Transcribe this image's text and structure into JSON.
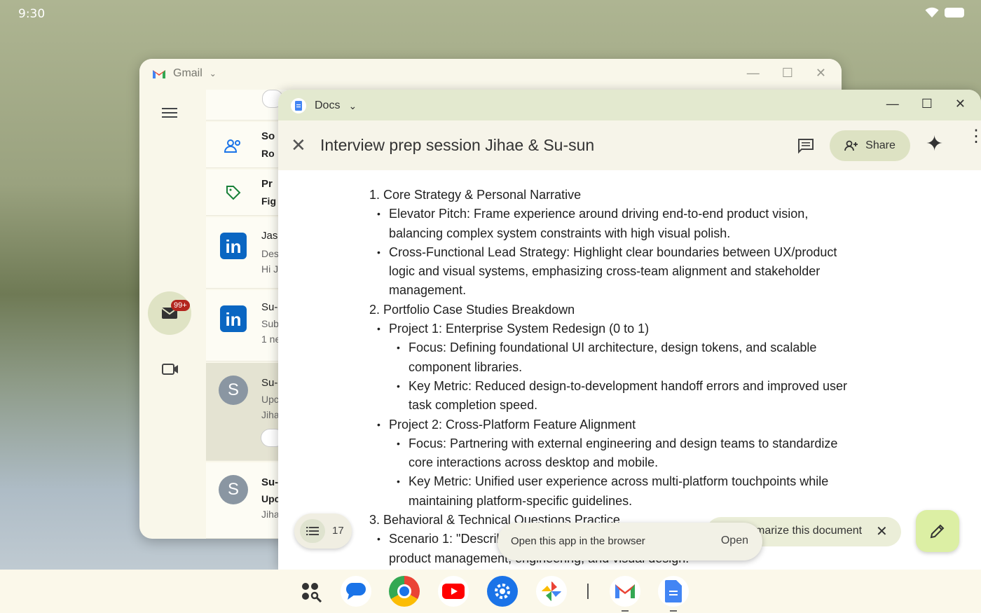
{
  "status_bar": {
    "time": "9:30"
  },
  "gmail": {
    "app_name": "Gmail",
    "badge": "99+",
    "rows": [
      {
        "line1": "So",
        "line2": "Ro"
      },
      {
        "line1": "Pr",
        "line2": "Fig"
      },
      {
        "line1": "Jas",
        "line2": "Des",
        "line3": "Hi J"
      },
      {
        "line1": "Su-",
        "line2": "Sub",
        "line3": "1 ne"
      },
      {
        "avatar": "S",
        "line1": "Su-",
        "line2": "Upc",
        "line3": "Jiha"
      },
      {
        "avatar": "S",
        "line1": "Su-",
        "line2": "Upc",
        "line3": "Jiha"
      }
    ]
  },
  "docs": {
    "app_name": "Docs",
    "title": "Interview prep session  Jihae & Su-sun",
    "share_label": "Share",
    "lines": [
      "1. Core Strategy & Personal Narrative",
      "Elevator Pitch: Frame experience around driving end-to-end product vision,",
      "balancing complex system constraints with high visual polish.",
      "Cross-Functional Lead Strategy: Highlight clear boundaries between UX/product",
      "logic and visual systems, emphasizing cross-team alignment and stakeholder",
      "management.",
      "2. Portfolio Case Studies Breakdown",
      "Project 1: Enterprise System Redesign (0 to 1)",
      "Focus: Defining foundational UI architecture, design tokens, and scalable",
      "component libraries.",
      "Key Metric: Reduced design-to-development handoff errors and improved user",
      "task completion speed.",
      "Project 2: Cross-Platform Feature Alignment",
      "Focus: Partnering with external engineering and design teams to standardize",
      "core interactions across desktop and mobile.",
      "Key Metric: Unified user experience across multi-platform touchpoints while",
      "maintaining platform-specific guidelines.",
      "3. Behavioral & Technical Questions Practice",
      "Scenario 1: \"Describ",
      "product management, engineering, and visual design.\""
    ],
    "outline_count": "17",
    "summarize_label": "marize this document",
    "snackbar_text": "Open this app in the browser",
    "snackbar_action": "Open"
  },
  "colors": {
    "accent": "#dcefa4",
    "share_bg": "#dde2c3",
    "titlebar": "#e3e9cf"
  }
}
